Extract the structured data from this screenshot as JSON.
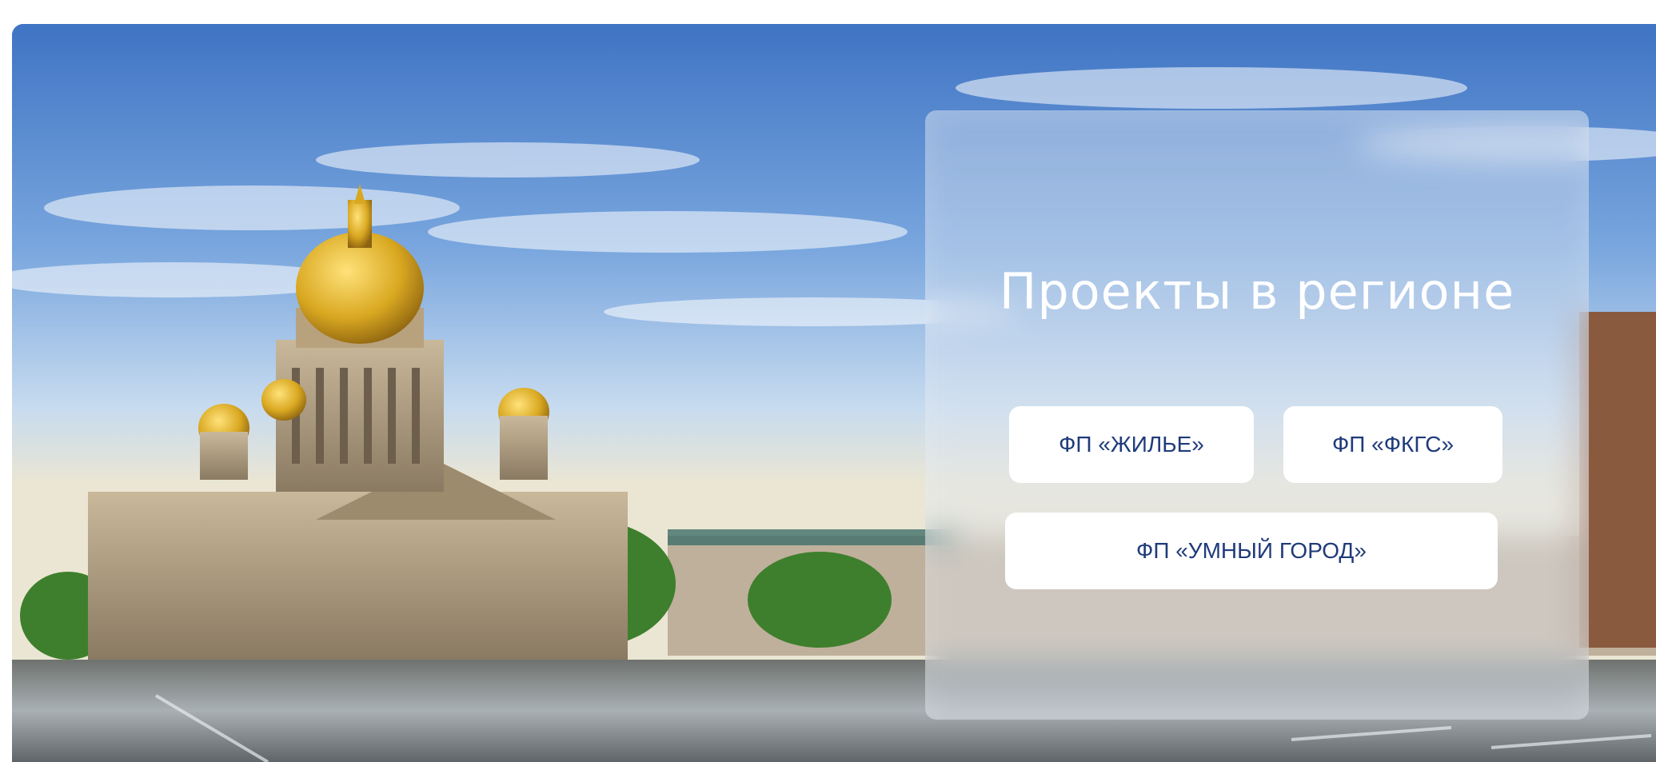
{
  "hero": {
    "background_image": "saint-isaacs-cathedral-photo",
    "title": "Проекты в регионе",
    "buttons": [
      {
        "label": "ФП «ЖИЛЬЕ»"
      },
      {
        "label": "ФП «ФКГС»"
      },
      {
        "label": "ФП «УМНЫЙ ГОРОД»"
      }
    ]
  },
  "colors": {
    "button_text": "#1f3b7a",
    "button_bg": "#ffffff",
    "title_text": "#ffffff",
    "dome_gold": "#d9a821"
  }
}
